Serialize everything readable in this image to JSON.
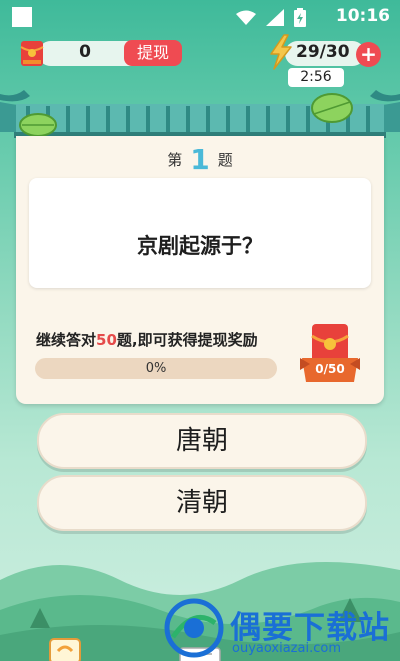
{
  "status_bar": {
    "time": "10:16"
  },
  "top_bar": {
    "coin_count": "0",
    "withdraw_label": "提现",
    "energy_count": "29/30",
    "plus_label": "+",
    "timer": "2:56"
  },
  "question": {
    "number_prefix": "第",
    "number": "1",
    "number_suffix": "题",
    "text": "京剧起源于？"
  },
  "progress": {
    "label_before": "继续答对",
    "label_highlight": "50",
    "label_after": "题,即可获得提现奖励",
    "percent_text": "0%",
    "fraction": 0,
    "reward_count": "0/50"
  },
  "options": [
    {
      "label": "唐朝"
    },
    {
      "label": "清朝"
    }
  ],
  "watermark": {
    "title": "偶要下载站",
    "url": "ouyaoxiazai.com"
  },
  "colors": {
    "accent_red": "#ef4b52",
    "question_number": "#4ab9d8",
    "highlight": "#e54b4b"
  },
  "icons": [
    "wifi-icon",
    "signal-icon",
    "battery-icon",
    "red-packet-icon",
    "lightning-icon",
    "plus-icon",
    "leaf-icon",
    "reward-red-packet-icon",
    "watermark-logo-icon"
  ]
}
